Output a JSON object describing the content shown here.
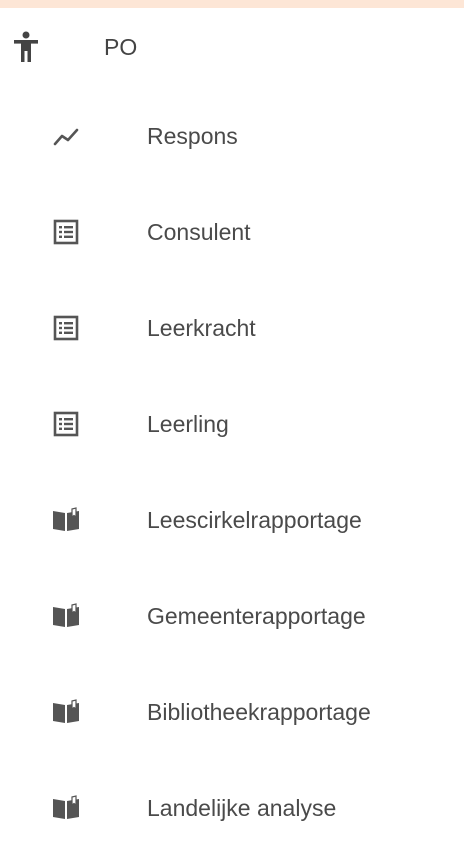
{
  "header": {
    "label": "PO",
    "icon": "accessibility-icon"
  },
  "menu": {
    "items": [
      {
        "label": "Respons",
        "icon": "trend-line-icon"
      },
      {
        "label": "Consulent",
        "icon": "list-icon"
      },
      {
        "label": "Leerkracht",
        "icon": "list-icon"
      },
      {
        "label": "Leerling",
        "icon": "list-icon"
      },
      {
        "label": "Leescirkelrapportage",
        "icon": "book-icon"
      },
      {
        "label": "Gemeenterapportage",
        "icon": "book-icon"
      },
      {
        "label": "Bibliotheekrapportage",
        "icon": "book-icon"
      },
      {
        "label": "Landelijke analyse",
        "icon": "book-icon"
      }
    ]
  },
  "colors": {
    "frame": "#fde6d6",
    "panel": "#ffffff",
    "text": "#4a4a4a",
    "icon": "#555555"
  }
}
